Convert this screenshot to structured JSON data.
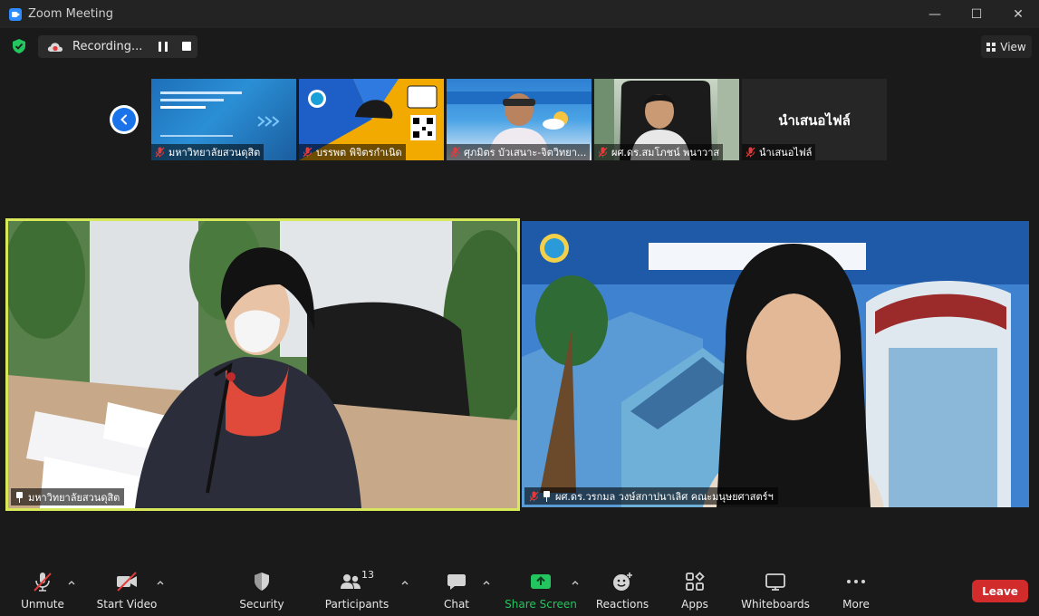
{
  "window": {
    "title": "Zoom Meeting",
    "minimize": "—",
    "maximize": "☐",
    "close": "✕"
  },
  "recording": {
    "label": "Recording..."
  },
  "view_button": {
    "label": "View"
  },
  "thumbnails": [
    {
      "name": "มหาวิทยาลัยสวนดุสิต"
    },
    {
      "name": "บรรพต พิจิตรกำเนิด"
    },
    {
      "name": "ศุภมิตร บัวเสนาะ-จิตวิทยา..."
    },
    {
      "name": "ผศ.ดร.สมโภชน์ พนาวาส"
    },
    {
      "name": "นำเสนอไฟล์",
      "tile_text": "นำเสนอไฟล์"
    }
  ],
  "main_tiles": {
    "left": {
      "name": "มหาวิทยาลัยสวนดุสิต"
    },
    "right": {
      "name": "ผศ.ดร.วรกมล วงษ์สกาปนาเลิศ คณะมนุษยศาสตร์ฯ"
    }
  },
  "toolbar": {
    "unmute": "Unmute",
    "start_video": "Start Video",
    "security": "Security",
    "participants": "Participants",
    "participants_count": "13",
    "chat": "Chat",
    "share_screen": "Share Screen",
    "reactions": "Reactions",
    "apps": "Apps",
    "whiteboards": "Whiteboards",
    "more": "More",
    "leave": "Leave"
  },
  "colors": {
    "accent_green": "#22c55e",
    "leave_red": "#d22b2b",
    "active_speaker_border": "#d7e85a",
    "nav_blue": "#1a73e8"
  }
}
